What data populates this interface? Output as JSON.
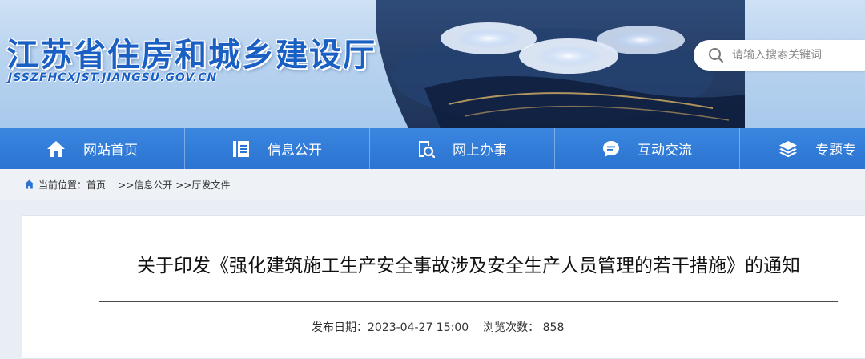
{
  "header": {
    "site_title": "江苏省住房和城乡建设厅",
    "site_domain": "JSSZFHCXJST.JIANGSU.GOV.CN",
    "search_placeholder": "请输入搜索关键词"
  },
  "nav": {
    "items": [
      {
        "label": "网站首页",
        "icon": "home-icon"
      },
      {
        "label": "信息公开",
        "icon": "document-icon"
      },
      {
        "label": "网上办事",
        "icon": "search-document-icon"
      },
      {
        "label": "互动交流",
        "icon": "chat-icon"
      },
      {
        "label": "专题专",
        "icon": "layers-icon"
      }
    ]
  },
  "breadcrumb": {
    "prefix": "当前位置：",
    "items": [
      "首页",
      ">>信息公开",
      ">>厅发文件"
    ]
  },
  "article": {
    "title": "关于印发《强化建筑施工生产安全事故涉及安全生产人员管理的若干措施》的通知",
    "publish_label": "发布日期：",
    "publish_date": "2023-04-27 15:00",
    "views_label": "浏览次数：",
    "views_count": "858"
  },
  "colors": {
    "brand_blue": "#1a5fc4",
    "nav_blue": "#2b74d1"
  }
}
